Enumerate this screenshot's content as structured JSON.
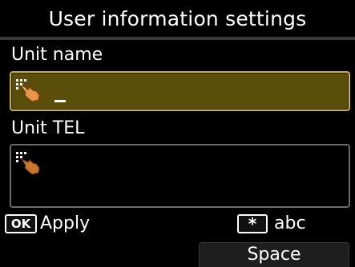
{
  "screen_title": "User information settings",
  "unit_name": {
    "label": "Unit name",
    "value": "",
    "icon": "touch-hand-icon"
  },
  "unit_tel": {
    "label": "Unit TEL",
    "value": "",
    "icon": "touch-hand-icon"
  },
  "footer": {
    "ok_key": "OK",
    "apply_label": "Apply",
    "star_key": "*",
    "mode_label": "abc",
    "space_label": "Space"
  },
  "colors": {
    "background": "#000000",
    "active_field_fill": "#5a4e0a",
    "active_field_border": "#c8b23a",
    "inactive_field_border": "#6a6a6a",
    "text": "#ffffff"
  }
}
